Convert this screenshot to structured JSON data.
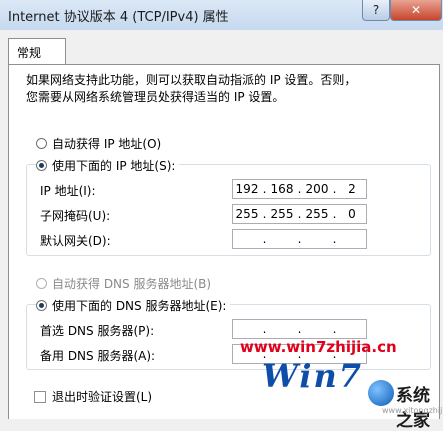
{
  "window": {
    "title": "Internet 协议版本 4 (TCP/IPv4) 属性",
    "help_label": "?",
    "close_label": "✕"
  },
  "tabs": [
    {
      "label": "常规"
    }
  ],
  "description": {
    "line1": "如果网络支持此功能，则可以获取自动指派的 IP 设置。否则，",
    "line2": "您需要从网络系统管理员处获得适当的 IP 设置。"
  },
  "ip_section": {
    "auto_label": "自动获得 IP 地址(O)",
    "manual_label": "使用下面的 IP 地址(S):",
    "selected": "manual",
    "fields": [
      {
        "label": "IP 地址(I):",
        "octets": [
          "192",
          "168",
          "200",
          "2"
        ]
      },
      {
        "label": "子网掩码(U):",
        "octets": [
          "255",
          "255",
          "255",
          "0"
        ]
      },
      {
        "label": "默认网关(D):",
        "octets": [
          "",
          "",
          "",
          ""
        ]
      }
    ]
  },
  "dns_section": {
    "auto_label": "自动获得 DNS 服务器地址(B)",
    "manual_label": "使用下面的 DNS 服务器地址(E):",
    "selected": "manual",
    "fields": [
      {
        "label": "首选 DNS 服务器(P):",
        "octets": [
          "",
          "",
          "",
          ""
        ]
      },
      {
        "label": "备用 DNS 服务器(A):",
        "octets": [
          "",
          "",
          "",
          ""
        ]
      }
    ]
  },
  "validate_on_exit": {
    "label": "退出时验证设置(L)",
    "checked": false
  },
  "watermark": {
    "site": "www.win7zhijia.cn",
    "logo": "Win7",
    "right_text": "系统之家",
    "right_url": "www.xitongzhijia.net"
  },
  "colors": {
    "titlebar": "#c6d9ef",
    "close_button": "#c7452b",
    "watermark_red": "#e0001b",
    "watermark_blue": "#0f4ea8"
  }
}
